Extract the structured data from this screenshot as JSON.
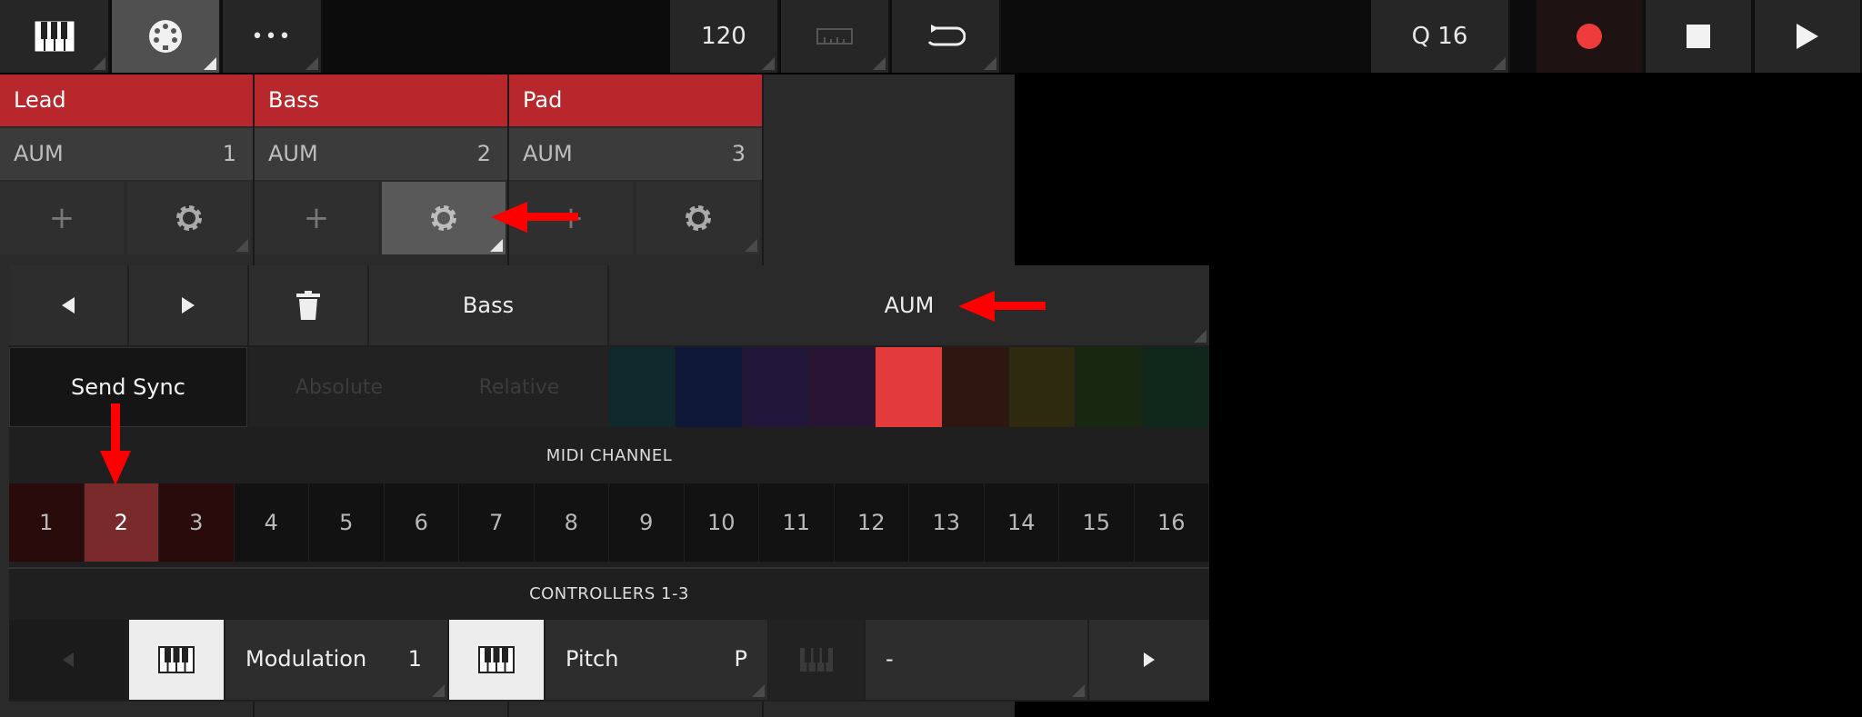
{
  "topbar": {
    "keyboard_icon": "piano-keys-icon",
    "midi_icon": "midi-din-icon",
    "more_label": "•••",
    "tempo": "120",
    "metronome_icon": "ruler-icon",
    "loop_icon": "loop-icon",
    "quantize": "Q 16",
    "record_icon": "record-icon",
    "stop_icon": "stop-icon",
    "play_icon": "play-icon"
  },
  "tracks": [
    {
      "name": "Lead",
      "device": "AUM",
      "channel": "1"
    },
    {
      "name": "Bass",
      "device": "AUM",
      "channel": "2"
    },
    {
      "name": "Pad",
      "device": "AUM",
      "channel": "3"
    }
  ],
  "track_buttons": {
    "add_label": "+"
  },
  "panel": {
    "prev_icon": "triangle-left-icon",
    "next_icon": "triangle-right-icon",
    "delete_icon": "trash-icon",
    "track_name": "Bass",
    "device_name": "AUM",
    "send_sync": "Send Sync",
    "absolute": "Absolute",
    "relative": "Relative",
    "colors": [
      "#10272c",
      "#10183a",
      "#22173a",
      "#2a1433",
      "#e33a3c",
      "#2e1710",
      "#2e2a10",
      "#182810",
      "#10281c"
    ],
    "selected_color_index": 4,
    "midi_channel_label": "MIDI CHANNEL",
    "channels": [
      "1",
      "2",
      "3",
      "4",
      "5",
      "6",
      "7",
      "8",
      "9",
      "10",
      "11",
      "12",
      "13",
      "14",
      "15",
      "16"
    ],
    "selected_channel": "2",
    "controllers_label": "CONTROLLERS 1-3",
    "controllers": [
      {
        "name": "Modulation",
        "value": "1"
      },
      {
        "name": "Pitch",
        "value": "P"
      },
      {
        "name": "-",
        "value": ""
      }
    ]
  },
  "accent": "#ff0000"
}
